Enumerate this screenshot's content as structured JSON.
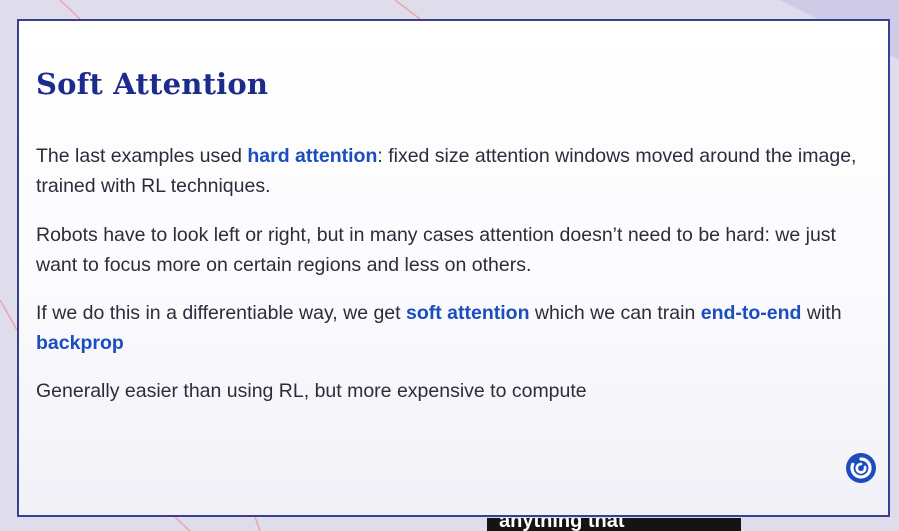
{
  "slide": {
    "title": "Soft Attention",
    "paragraphs": [
      {
        "t1": "The last examples used ",
        "h1": "hard attention",
        "t2": ": fixed size attention windows moved around the image, trained with RL techniques."
      },
      {
        "t1": "Robots have to look left or right, but in many cases attention doesn’t need to be hard: we just want to focus more on certain regions and less on others."
      },
      {
        "t1": "If we do this in a differentiable way, we get ",
        "h1": "soft attention",
        "t2": " which we can train ",
        "h2": "end-to-end",
        "t3": " with ",
        "h3": "backprop"
      },
      {
        "t1": "Generally easier than using RL, but more expensive to compute"
      }
    ],
    "highlight_color": "#1b4dbf",
    "title_color": "#1c2c8c",
    "logo_icon": "deepmind-logo-icon"
  },
  "caption": {
    "text": "anything that"
  }
}
